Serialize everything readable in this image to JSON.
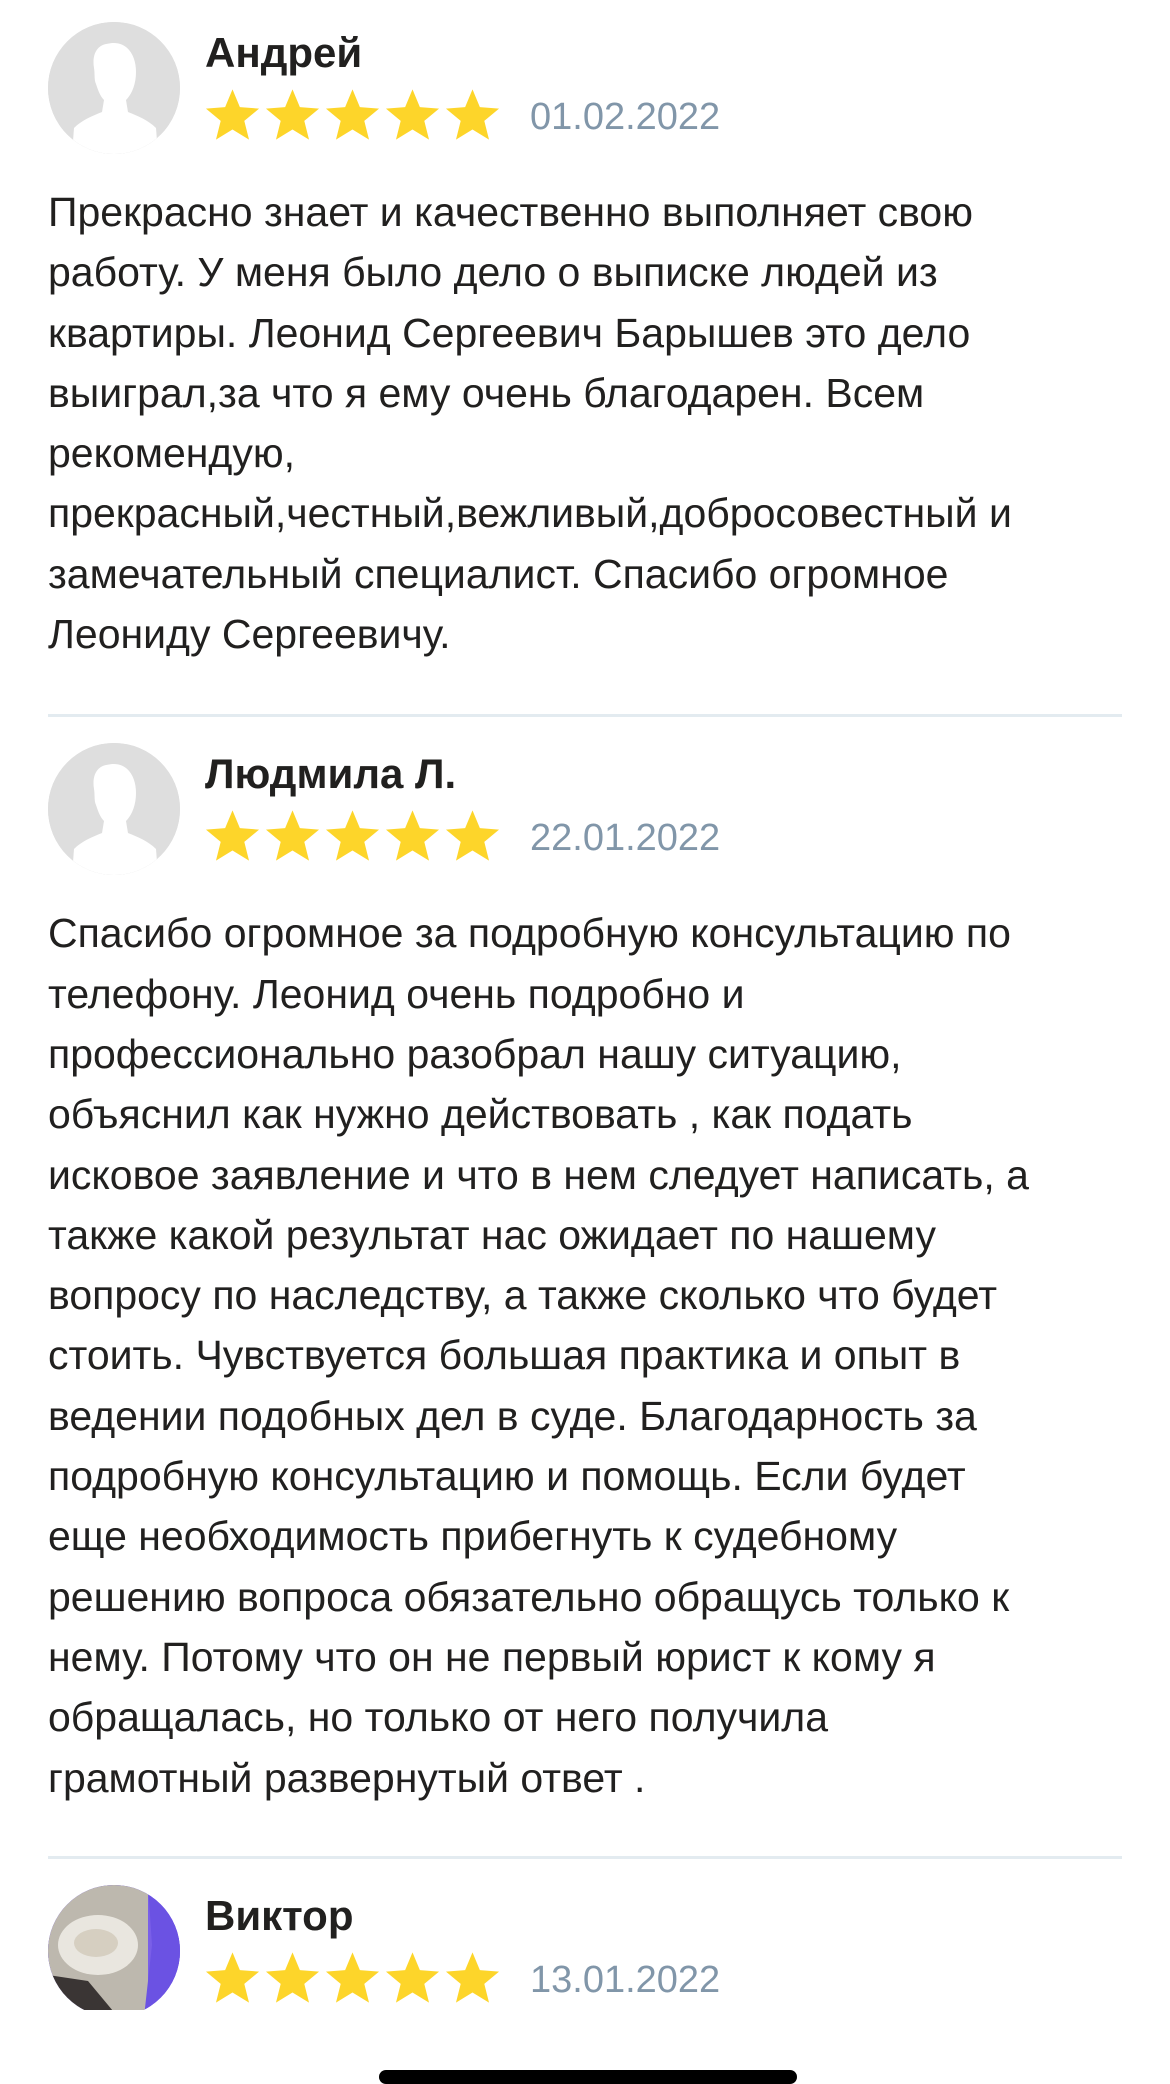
{
  "reviews": [
    {
      "author": "Андрей",
      "date": "01.02.2022",
      "rating": 5,
      "avatar": "default-person-icon",
      "lines": [
        "Прекрасно знает и качественно выполняет свою",
        "работу. У меня было дело о выписке людей из",
        "квартиры. Леонид Сергеевич Барышев это дело",
        "выиграл,за что я ему очень благодарен. Всем",
        "рекомендую,",
        "прекрасный,честный,вежливый,добросовестный и",
        "замечательный специалист. Спасибо огромное",
        "Леониду Сергеевичу."
      ]
    },
    {
      "author": "Людмила Л.",
      "date": "22.01.2022",
      "rating": 5,
      "avatar": "default-person-icon",
      "lines": [
        "Спасибо огромное за подробную консультацию по",
        "телефону. Леонид очень подробно и",
        "профессионально разобрал нашу ситуацию,",
        "объяснил как нужно действовать , как подать",
        "исковое заявление и что в нем следует написать, а",
        "также какой результат нас ожидает по нашему",
        "вопросу по наследству, а также сколько что будет",
        "стоить. Чувствуется большая практика и опыт в",
        "ведении подобных дел в суде. Благодарность за",
        "подробную консультацию и помощь. Если будет",
        "еще необходимость прибегнуть к судебному",
        "решению вопроса обязательно обращусь только к",
        "нему. Потому что он не первый юрист к кому я",
        "обращалась, но только от него получила",
        "грамотный развернутый ответ ."
      ]
    },
    {
      "author": "Виктор",
      "date": "13.01.2022",
      "rating": 5,
      "avatar": "user-photo",
      "lines": []
    }
  ],
  "colors": {
    "star": "#fdd52a",
    "date": "#8196a9",
    "text": "#21201f",
    "divider": "#e3ebf0",
    "avatar_bg": "#dedede"
  }
}
